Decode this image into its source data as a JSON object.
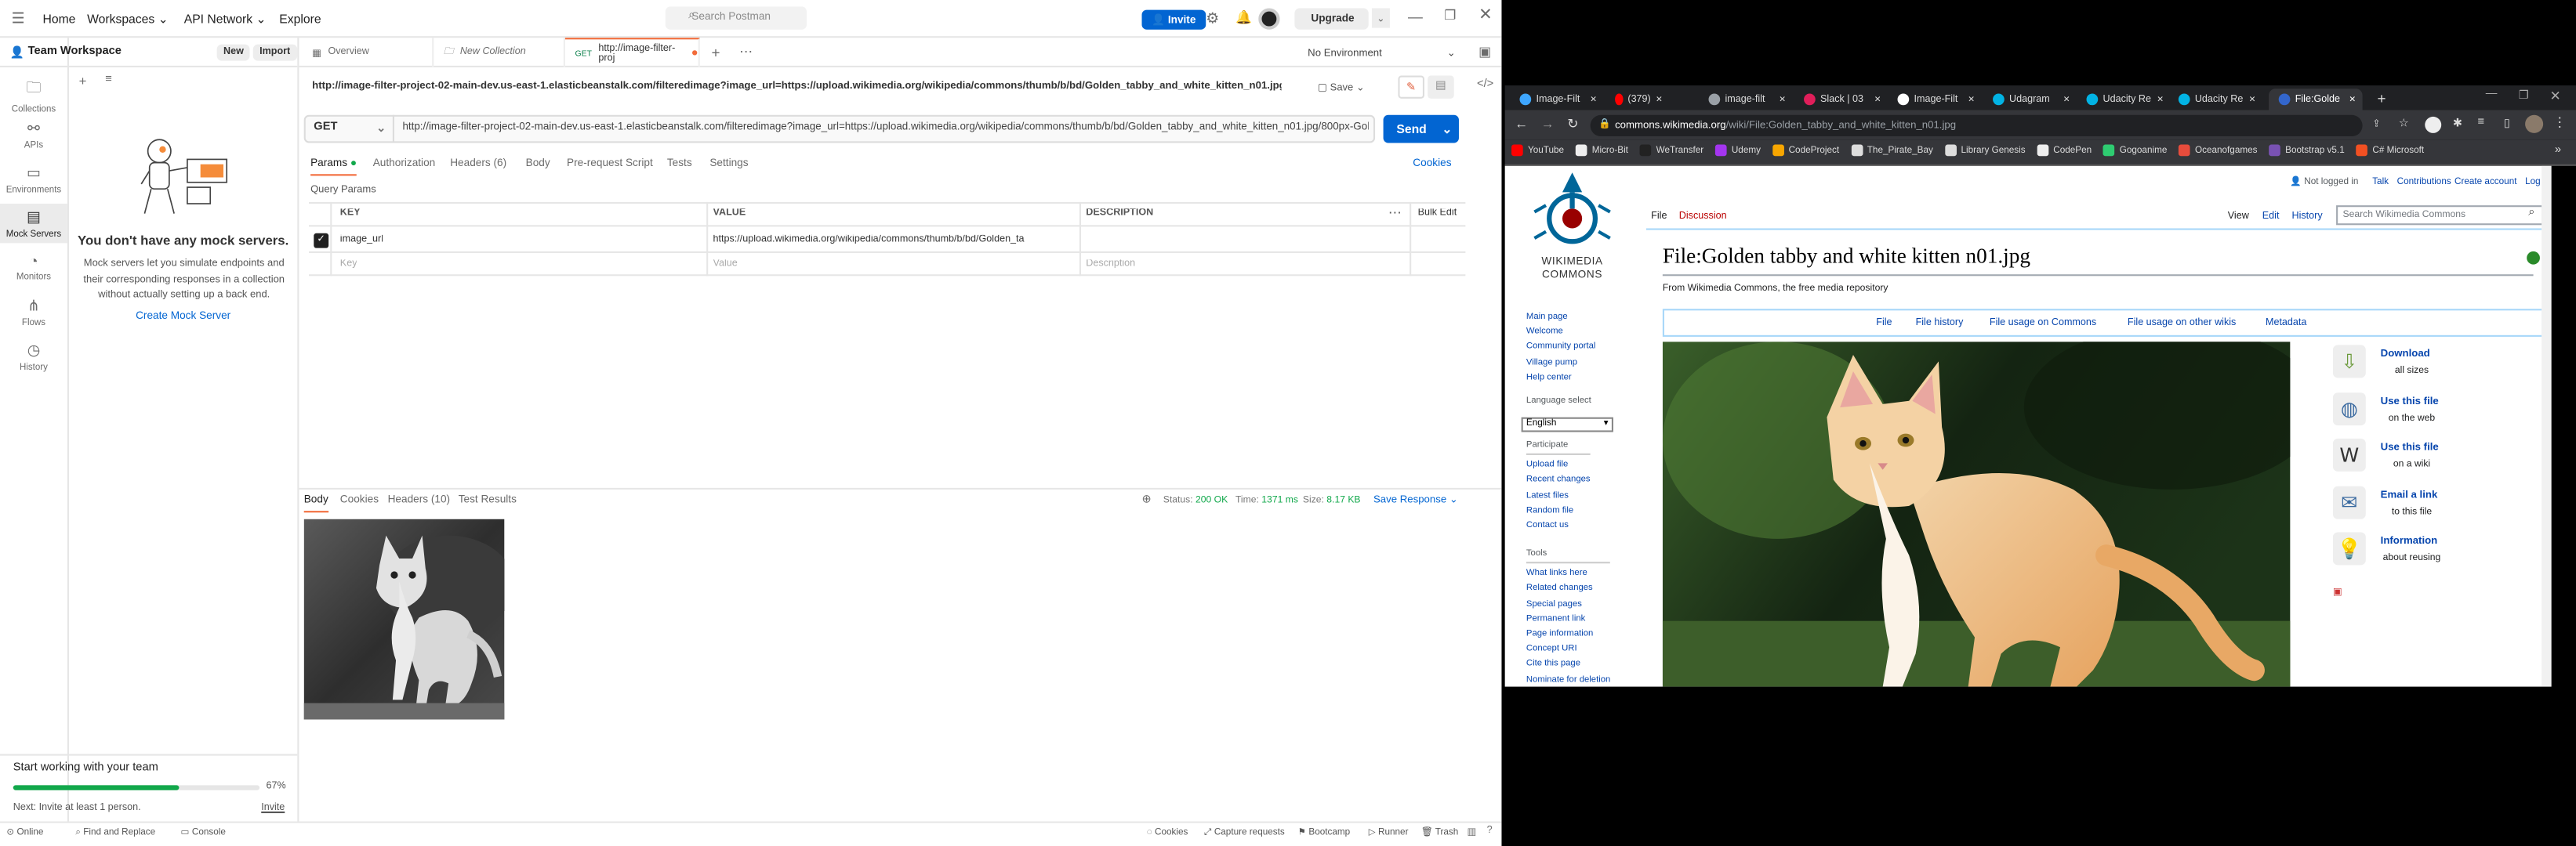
{
  "postman": {
    "nav": {
      "home": "Home",
      "workspaces": "Workspaces",
      "api_network": "API Network",
      "explore": "Explore",
      "search_placeholder": "Search Postman",
      "invite": "Invite",
      "upgrade": "Upgrade"
    },
    "workspace": {
      "name": "Team Workspace",
      "new": "New",
      "import": "Import"
    },
    "rail": [
      "Collections",
      "APIs",
      "Environments",
      "Mock Servers",
      "Monitors",
      "Flows",
      "History"
    ],
    "mock": {
      "title": "You don't have any mock servers.",
      "desc": "Mock servers let you simulate endpoints and their corresponding responses in a collection without actually setting up a back end.",
      "create": "Create Mock Server"
    },
    "team": {
      "title": "Start working with your team",
      "percent": "67%",
      "progress": 0.67,
      "next": "Next: Invite at least 1 person.",
      "invite": "Invite"
    },
    "tabs": [
      {
        "label": "Overview"
      },
      {
        "label": "New Collection"
      },
      {
        "method": "GET",
        "label": "http://image-filter-proj"
      }
    ],
    "environment": "No Environment",
    "request": {
      "url_title": "http://image-filter-project-02-main-dev.us-east-1.elasticbeanstalk.com/filteredimage?image_url=https://upload.wikimedia.org/wikipedia/commons/thumb/b/bd/Golden_tabby_and_white_kitten_n01.jpg/800px-...",
      "save": "Save",
      "method": "GET",
      "url": "http://image-filter-project-02-main-dev.us-east-1.elasticbeanstalk.com/filteredimage?image_url=https://upload.wikimedia.org/wikipedia/commons/thumb/b/bd/Golden_tabby_and_white_kitten_n01.jpg/800px-Golden...",
      "send": "Send",
      "cookies": "Cookies"
    },
    "req_tabs": [
      "Params",
      "Authorization",
      "Headers (6)",
      "Body",
      "Pre-request Script",
      "Tests",
      "Settings"
    ],
    "query_params": "Query Params",
    "table": {
      "key": "KEY",
      "value": "VALUE",
      "description": "DESCRIPTION",
      "bulk": "Bulk Edit",
      "row_key": "image_url",
      "row_value": "https://upload.wikimedia.org/wikipedia/commons/thumb/b/bd/Golden_ta",
      "ph_key": "Key",
      "ph_value": "Value",
      "ph_desc": "Description"
    },
    "resp_tabs": [
      "Body",
      "Cookies",
      "Headers (10)",
      "Test Results"
    ],
    "response": {
      "status_label": "Status:",
      "status": "200 OK",
      "time_label": "Time:",
      "time": "1371 ms",
      "size_label": "Size:",
      "size": "8.17 KB",
      "save": "Save Response"
    },
    "footer": {
      "online": "Online",
      "find": "Find and Replace",
      "console": "Console",
      "cookies": "Cookies",
      "capture": "Capture requests",
      "bootcamp": "Bootcamp",
      "runner": "Runner",
      "trash": "Trash"
    }
  },
  "browser": {
    "tabs": [
      "Image-Filt",
      "(379)",
      "image-filt",
      "Slack | 03",
      "Image-Filt",
      "Udagram",
      "Udacity Re",
      "Udacity Re",
      "File:Golde"
    ],
    "address": "commons.wikimedia.org/wiki/File:Golden_tabby_and_white_kitten_n01.jpg",
    "address_host": "commons.wikimedia.org",
    "address_path": "/wiki/File:Golden_tabby_and_white_kitten_n01.jpg",
    "bookmarks": [
      {
        "label": "YouTube",
        "color": "#ff0000"
      },
      {
        "label": "Micro-Bit",
        "color": "#eeeeee"
      },
      {
        "label": "WeTransfer",
        "color": "#222222"
      },
      {
        "label": "Udemy",
        "color": "#a435f0"
      },
      {
        "label": "CodeProject",
        "color": "#f7a600"
      },
      {
        "label": "The_Pirate_Bay",
        "color": "#dddddd"
      },
      {
        "label": "Library Genesis",
        "color": "#dddddd"
      },
      {
        "label": "CodePen",
        "color": "#eeeeee"
      },
      {
        "label": "Gogoanime",
        "color": "#2ecc71"
      },
      {
        "label": "Oceanofgames",
        "color": "#e74c3c"
      },
      {
        "label": "Bootstrap v5.1",
        "color": "#7952b3"
      },
      {
        "label": "C# Microsoft",
        "color": "#f25022"
      }
    ],
    "wiki": {
      "not_logged": "Not logged in",
      "talk": "Talk",
      "contributions": "Contributions",
      "create": "Create account",
      "login": "Log in",
      "tab_file": "File",
      "tab_discussion": "Discussion",
      "view": "View",
      "edit": "Edit",
      "history": "History",
      "search_placeholder": "Search Wikimedia Commons",
      "logo1": "WIKIMEDIA",
      "logo2": "COMMONS",
      "title": "File:Golden tabby and white kitten n01.jpg",
      "from": "From Wikimedia Commons, the free media repository",
      "file_nav": [
        "File",
        "File history",
        "File usage on Commons",
        "File usage on other wikis",
        "Metadata"
      ],
      "nav": [
        "Main page",
        "Welcome",
        "Community portal",
        "Village pump",
        "Help center"
      ],
      "language_label": "Language select",
      "language": "English",
      "participate": "Participate",
      "participate_items": [
        "Upload file",
        "Recent changes",
        "Latest files",
        "Random file",
        "Contact us"
      ],
      "tools": "Tools",
      "tools_items": [
        "What links here",
        "Related changes",
        "Special pages",
        "Permanent link",
        "Page information",
        "Concept URI",
        "Cite this page",
        "Nominate for deletion"
      ],
      "actions": [
        {
          "title": "Download",
          "sub": "all sizes"
        },
        {
          "title": "Use this file",
          "sub": "on the web"
        },
        {
          "title": "Use this file",
          "sub": "on a wiki"
        },
        {
          "title": "Email a link",
          "sub": "to this file"
        },
        {
          "title": "Information",
          "sub": "about reusing"
        }
      ]
    }
  }
}
